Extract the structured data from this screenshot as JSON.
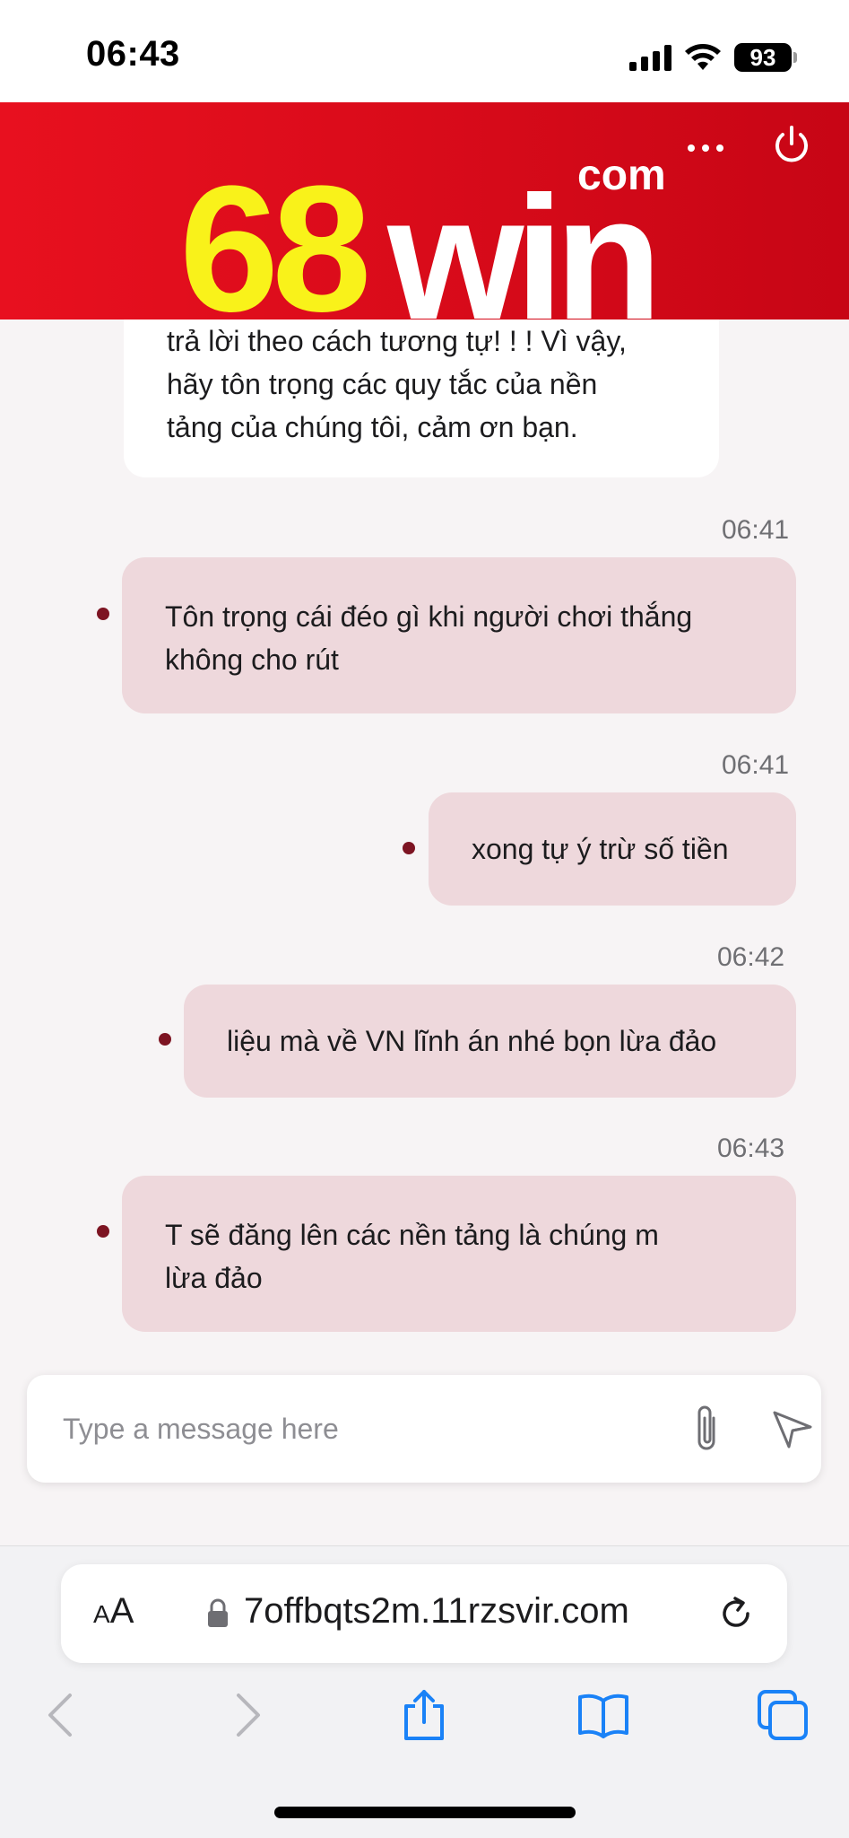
{
  "status_bar": {
    "time": "06:43",
    "battery": "93",
    "signal_icon": "cellular-signal-icon",
    "wifi_icon": "wifi-icon"
  },
  "header": {
    "logo": {
      "primary": "68",
      "secondary": "win",
      "suffix": "com"
    },
    "menu_icon": "more-dots-icon",
    "power_icon": "power-icon",
    "background_color": "#d90b1a",
    "logo_primary_color": "#f9f21a"
  },
  "messages": {
    "agent_partial": {
      "lines": [
        "trả lời theo cách tương tự! ! ! Vì vậy,",
        "hãy tôn trọng các quy tắc của nền",
        "tảng của chúng tôi, cảm ơn bạn."
      ]
    },
    "user": [
      {
        "time": "06:41",
        "lines": [
          "Tôn trọng cái đéo gì khi người chơi thắng",
          "không cho rút"
        ]
      },
      {
        "time": "06:41",
        "lines": [
          "xong tự ý trừ số tiền"
        ]
      },
      {
        "time": "06:42",
        "lines": [
          "liệu mà về VN lĩnh án nhé bọn lừa đảo"
        ]
      },
      {
        "time": "06:43",
        "lines": [
          "T sẽ đăng lên các nền tảng là chúng m",
          "lừa đảo"
        ]
      }
    ],
    "user_bubble_color": "#eed8dc",
    "status_dot_color": "#7d1422"
  },
  "composer": {
    "placeholder": "Type a message here",
    "attach_icon": "paperclip-icon",
    "send_icon": "send-icon"
  },
  "browser": {
    "aa_label": "AA",
    "url": "7offbqts2m.11rzsvir.com",
    "lock_icon": "lock-icon",
    "reload_icon": "reload-icon",
    "toolbar": [
      "back-icon",
      "forward-icon",
      "share-icon",
      "bookmarks-icon",
      "tabs-icon"
    ],
    "accent_color": "#1a82f7"
  }
}
